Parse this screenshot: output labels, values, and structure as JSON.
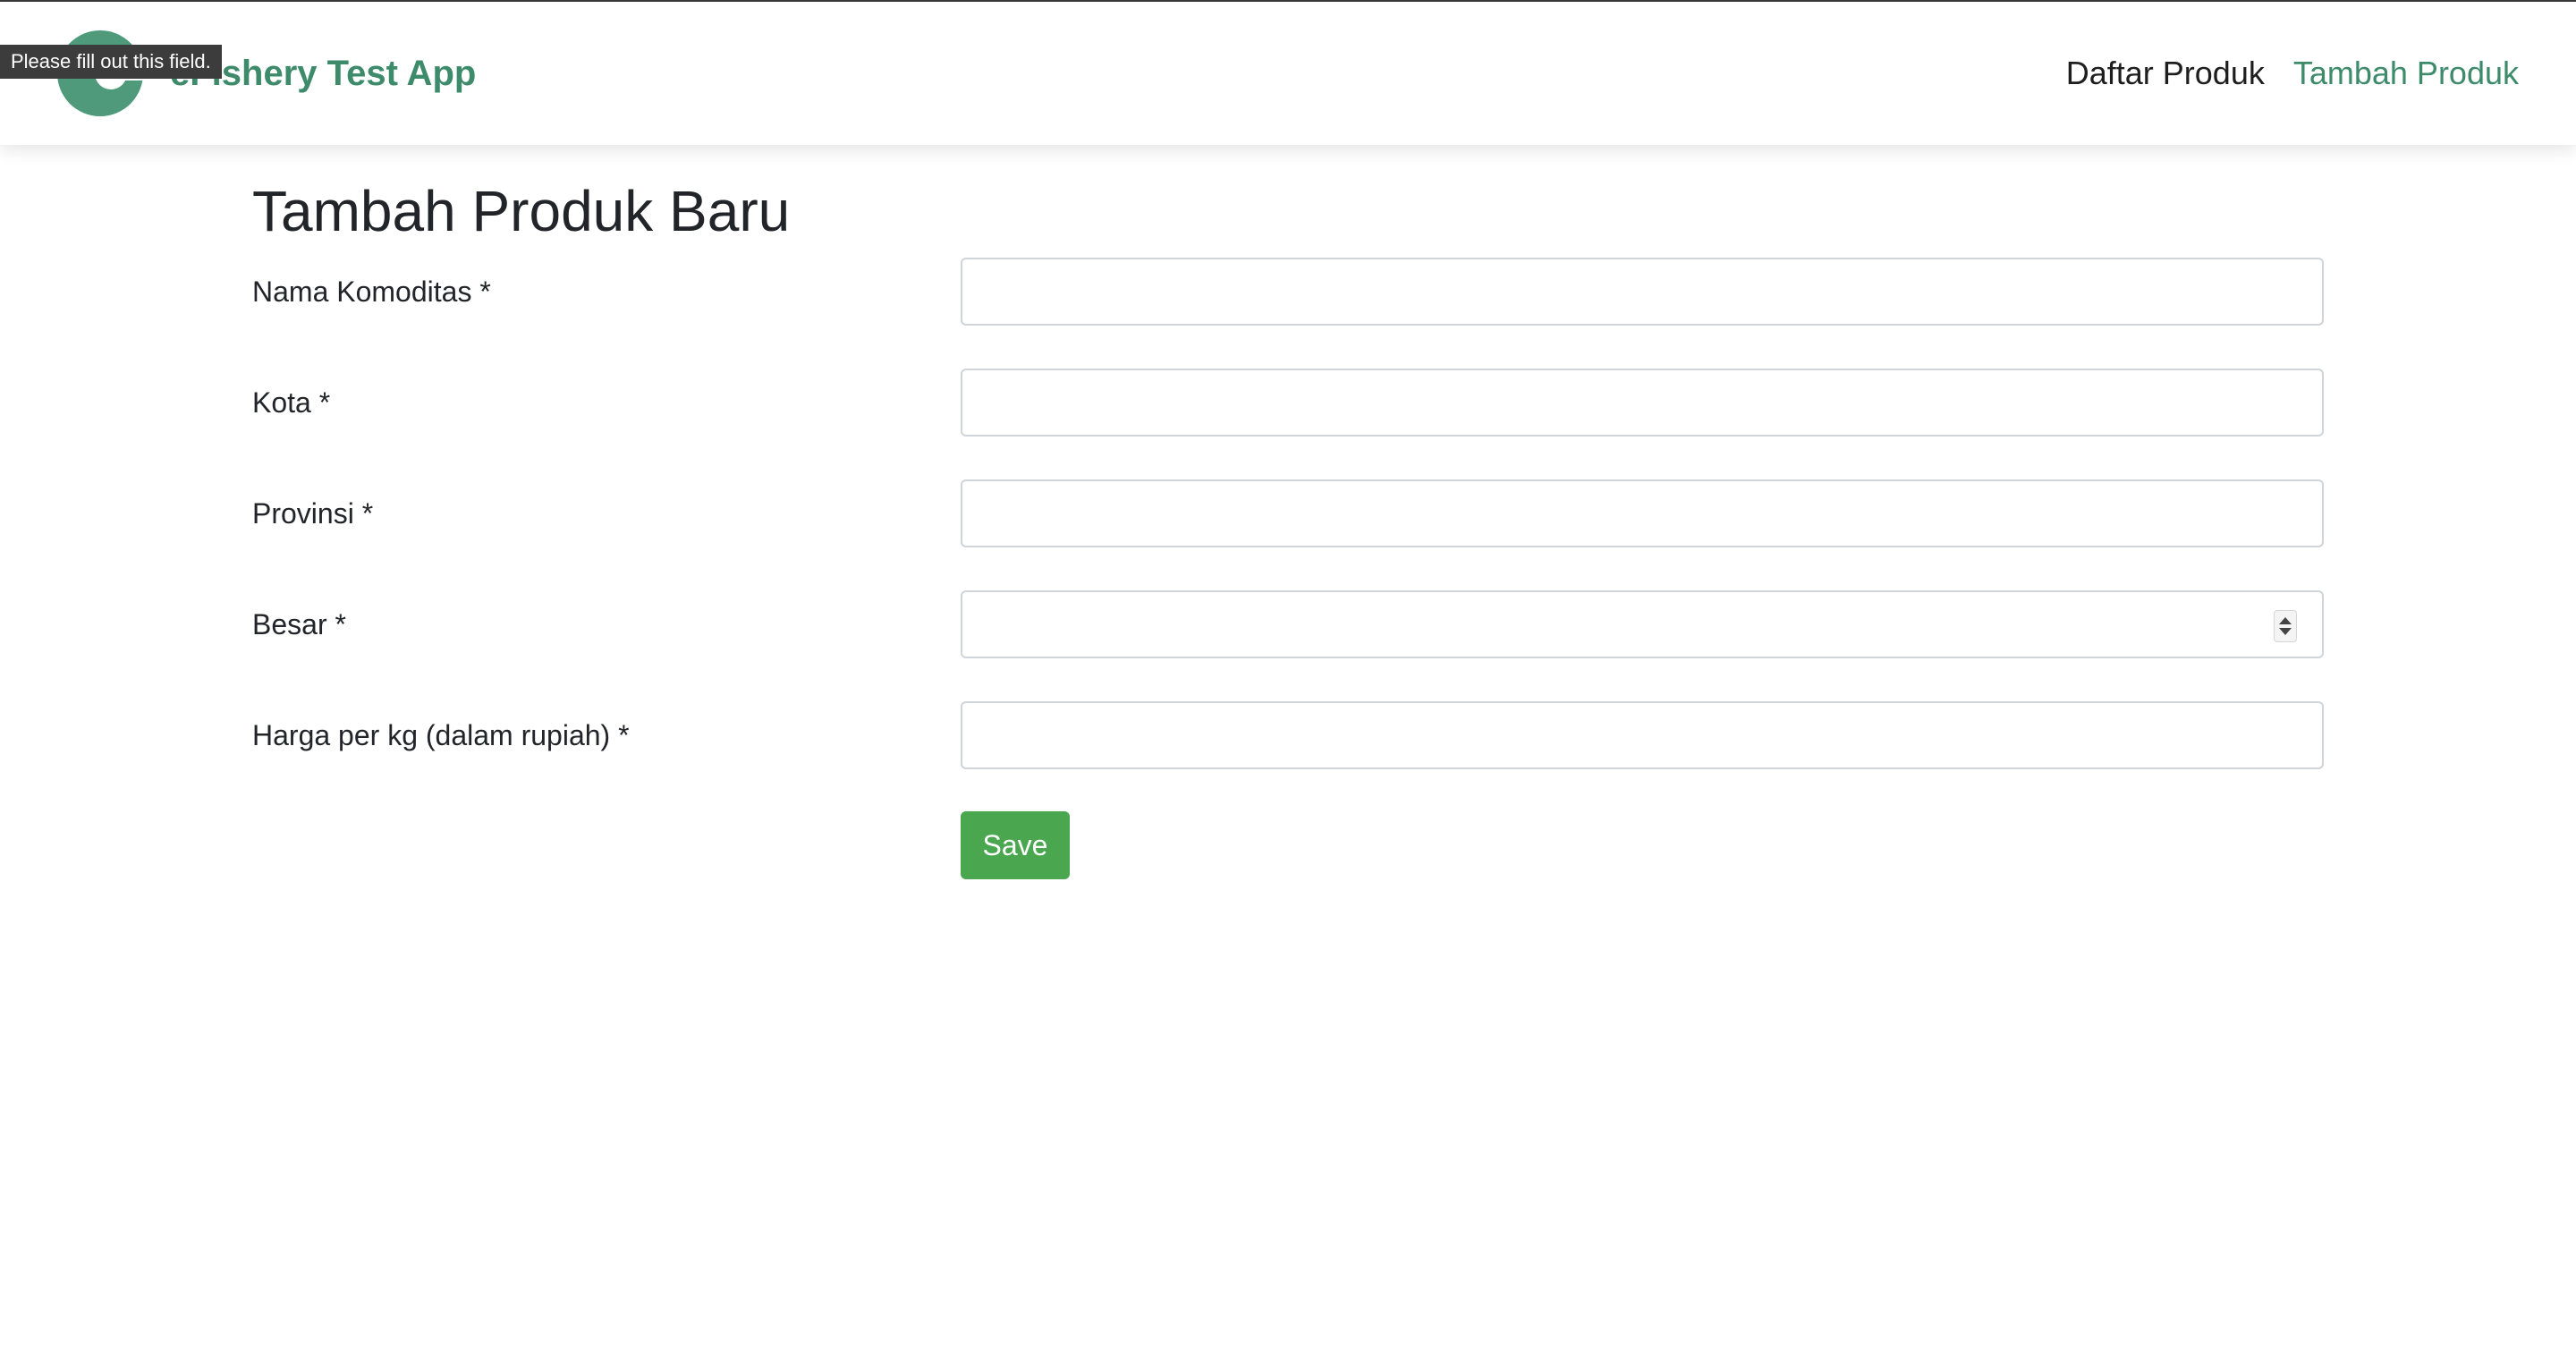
{
  "tooltip": {
    "text": "Please fill out this field."
  },
  "header": {
    "brand": "eFishery Test App",
    "logo_icon": "efishery-logo-icon",
    "brand_color": "#3d8b6a",
    "nav": [
      {
        "label": "Daftar Produk",
        "active": false
      },
      {
        "label": "Tambah Produk",
        "active": true
      }
    ]
  },
  "main": {
    "title": "Tambah Produk Baru",
    "fields": [
      {
        "label": "Nama Komoditas *",
        "value": "",
        "type": "text"
      },
      {
        "label": "Kota *",
        "value": "",
        "type": "text"
      },
      {
        "label": "Provinsi *",
        "value": "",
        "type": "text"
      },
      {
        "label": "Besar *",
        "value": "",
        "type": "number"
      },
      {
        "label": "Harga per kg (dalam rupiah) *",
        "value": "",
        "type": "text"
      }
    ],
    "save_label": "Save",
    "save_color": "#4aa64f"
  }
}
